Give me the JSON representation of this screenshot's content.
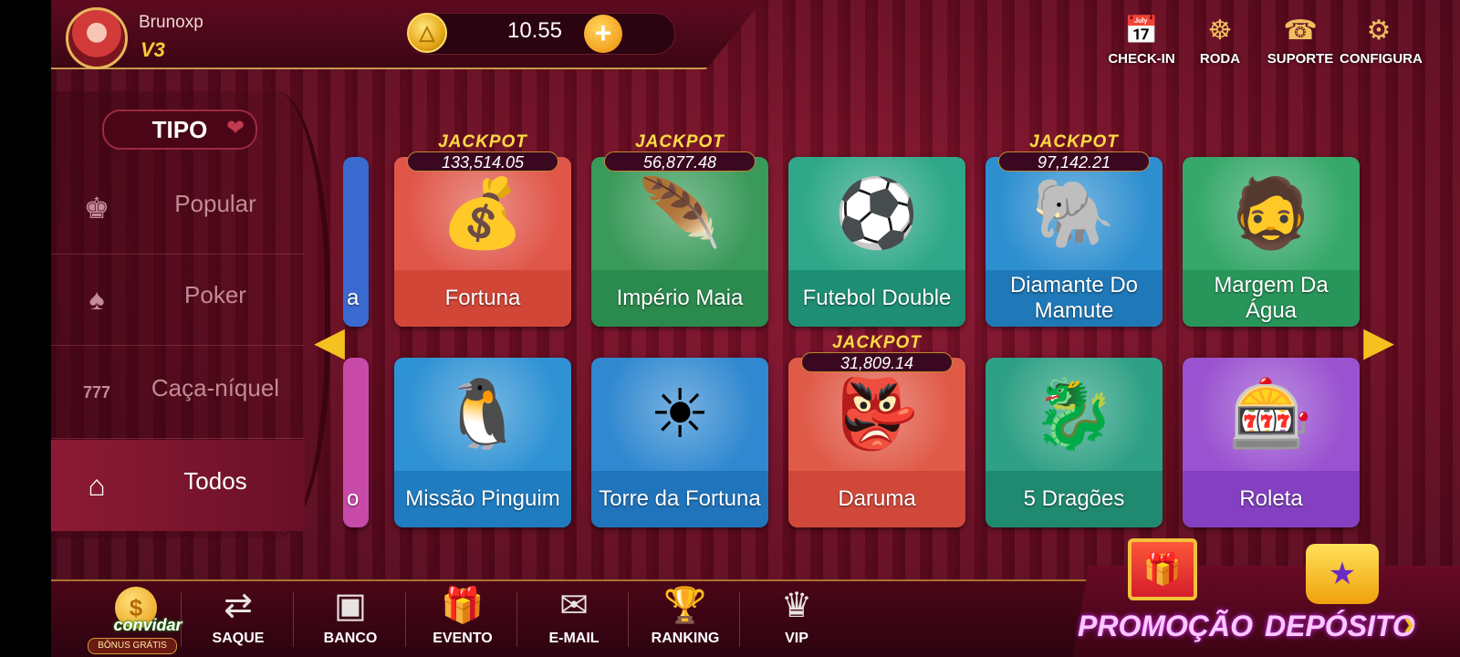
{
  "header": {
    "username": "Brunoxp",
    "vip_level": "V3",
    "coin_symbol": "△",
    "balance": "10.55",
    "add_symbol": "+",
    "actions": [
      {
        "name": "check-in-button",
        "icon": "calendar-check-icon",
        "glyph": "📅",
        "label": "CHECK-IN"
      },
      {
        "name": "roda-button",
        "icon": "wheel-icon",
        "glyph": "☸",
        "label": "RODA"
      },
      {
        "name": "suporte-button",
        "icon": "support-24h-icon",
        "glyph": "☎",
        "label": "SUPORTE"
      },
      {
        "name": "configura-button",
        "icon": "gear-icon",
        "glyph": "⚙",
        "label": "CONFIGURA"
      }
    ]
  },
  "sidebar": {
    "title": "TIPO",
    "items": [
      {
        "icon": "crown-icon",
        "glyph": "♚",
        "label": "Popular",
        "active": false
      },
      {
        "icon": "poker-icon",
        "glyph": "♠",
        "label": "Poker",
        "active": false
      },
      {
        "icon": "slot-777-icon",
        "glyph": "777",
        "label": "Caça-níquel",
        "active": false
      },
      {
        "icon": "home-icon",
        "glyph": "⌂",
        "label": "Todos",
        "active": true
      }
    ]
  },
  "games": {
    "partial_left_top": "a",
    "partial_left_bottom": "o",
    "cards": [
      {
        "name": "Fortuna",
        "jackpot_label": "JACKPOT",
        "jackpot": "133,514.05",
        "color": "#e0574a",
        "band": "#d24638",
        "glyph": "💰"
      },
      {
        "name": "Império Maia",
        "jackpot_label": "JACKPOT",
        "jackpot": "56,877.48",
        "color": "#3a9a5a",
        "band": "#2b8a4d",
        "glyph": "🪶"
      },
      {
        "name": "Futebol Double",
        "jackpot_label": "",
        "jackpot": "",
        "color": "#2ea888",
        "band": "#1e8f74",
        "glyph": "⚽"
      },
      {
        "name": "Diamante Do Mamute",
        "jackpot_label": "JACKPOT",
        "jackpot": "97,142.21",
        "color": "#2e8fd0",
        "band": "#1f78b8",
        "glyph": "🐘"
      },
      {
        "name": "Margem Da Água",
        "jackpot_label": "",
        "jackpot": "",
        "color": "#36a86a",
        "band": "#28955a",
        "glyph": "🧔"
      },
      {
        "name": "Missão Pinguim",
        "jackpot_label": "",
        "jackpot": "",
        "color": "#2f92d4",
        "band": "#1f7cc0",
        "glyph": "🐧"
      },
      {
        "name": "Torre da Fortuna",
        "jackpot_label": "",
        "jackpot": "",
        "color": "#2f88d0",
        "band": "#2074bc",
        "glyph": "☀"
      },
      {
        "name": "Daruma",
        "jackpot_label": "JACKPOT",
        "jackpot": "31,809.14",
        "color": "#e05a48",
        "band": "#d0483a",
        "glyph": "👺"
      },
      {
        "name": "5 Dragões",
        "jackpot_label": "",
        "jackpot": "",
        "color": "#2ea084",
        "band": "#208a70",
        "glyph": "🐉"
      },
      {
        "name": "Roleta",
        "jackpot_label": "",
        "jackpot": "",
        "color": "#9a52d0",
        "band": "#8440c0",
        "glyph": "🎰"
      }
    ]
  },
  "bottom_nav": {
    "invite_label": "convidar",
    "invite_sub": "BÔNUS GRÁTIS",
    "items": [
      {
        "icon": "money-bag-icon",
        "glyph": "⇄",
        "label": "SAQUE"
      },
      {
        "icon": "safe-icon",
        "glyph": "▣",
        "label": "BANCO"
      },
      {
        "icon": "gift-icon",
        "glyph": "🎁",
        "label": "EVENTO"
      },
      {
        "icon": "mail-icon",
        "glyph": "✉",
        "label": "E-MAIL"
      },
      {
        "icon": "trophy-icon",
        "glyph": "🏆",
        "label": "RANKING"
      },
      {
        "icon": "vip-crown-icon",
        "glyph": "♛",
        "label": "VIP"
      }
    ],
    "promo_label": "PROMOÇÃO",
    "deposit_label": "DEPÓSITO"
  }
}
